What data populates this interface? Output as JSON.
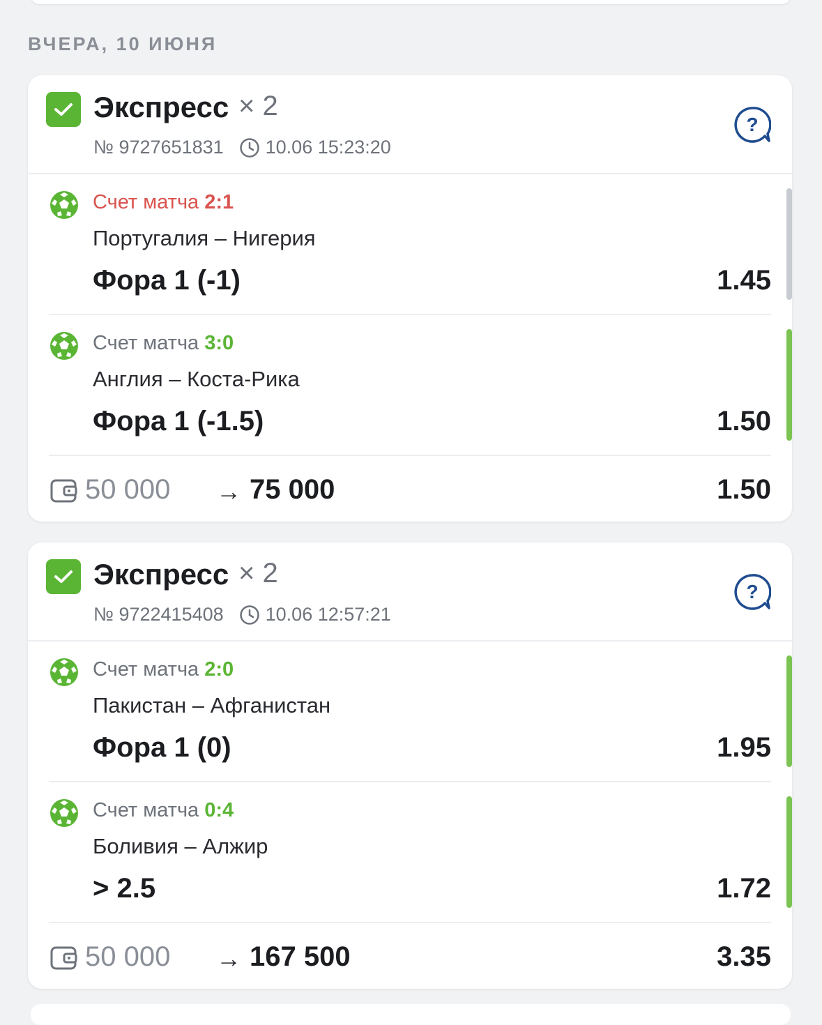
{
  "date_header": "ВЧЕРА, 10 ИЮНЯ",
  "colors": {
    "win": "#5bb535",
    "loss_score": "#d9534f",
    "neutral_bar": "#c8ccd2",
    "help": "#1f4c8f"
  },
  "cards": [
    {
      "title": "Экспресс",
      "multiplier": "× 2",
      "number": "№ 9727651831",
      "time": "10.06 15:23:20",
      "bets": [
        {
          "market": "Счет матча",
          "score": "2:1",
          "score_color": "#d9534f",
          "teams": "Португалия – Нигерия",
          "outcome": "Фора 1 (-1)",
          "odd": "1.45",
          "status": "neutral"
        },
        {
          "market": "Счет матча",
          "score": "3:0",
          "score_color": "#5bb535",
          "teams": "Англия – Коста-Рика",
          "outcome": "Фора 1 (-1.5)",
          "odd": "1.50",
          "status": "win"
        }
      ],
      "stake": "50 000",
      "arrow": "→",
      "payout": "75 000",
      "total_odd": "1.50"
    },
    {
      "title": "Экспресс",
      "multiplier": "× 2",
      "number": "№ 9722415408",
      "time": "10.06 12:57:21",
      "bets": [
        {
          "market": "Счет матча",
          "score": "2:0",
          "score_color": "#5bb535",
          "teams": "Пакистан – Афганистан",
          "outcome": "Фора 1 (0)",
          "odd": "1.95",
          "status": "win"
        },
        {
          "market": "Счет матча",
          "score": "0:4",
          "score_color": "#5bb535",
          "teams": "Боливия – Алжир",
          "outcome": "> 2.5",
          "odd": "1.72",
          "status": "win"
        }
      ],
      "stake": "50 000",
      "arrow": "→",
      "payout": "167 500",
      "total_odd": "3.35"
    }
  ]
}
